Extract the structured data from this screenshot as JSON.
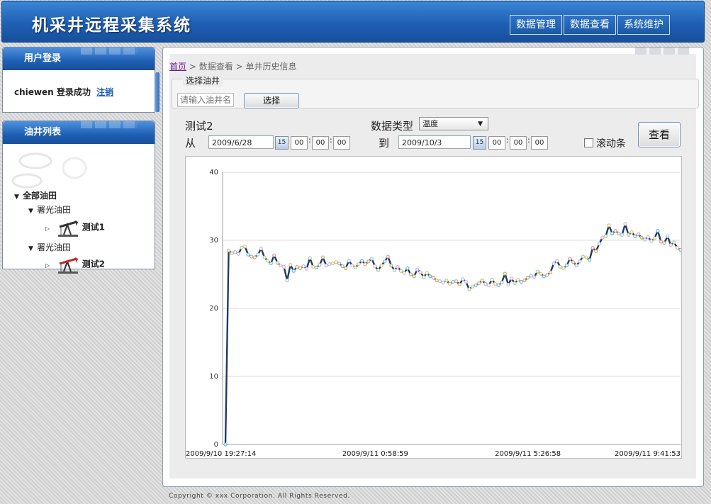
{
  "app": {
    "title": "机采井远程采集系统",
    "nav": [
      "数据管理",
      "数据查看",
      "系统维护"
    ]
  },
  "login_panel": {
    "title": "用户登录",
    "username": "chiewen",
    "status": "登录成功",
    "logout": "注销"
  },
  "well_list": {
    "title": "油井列表",
    "root": "全部油田",
    "fields": [
      {
        "name": "署光油田",
        "well": "测试1"
      },
      {
        "name": "署光油田",
        "well": "测试2"
      }
    ]
  },
  "breadcrumb": {
    "home": "首页",
    "sep": ">",
    "level2": "数据查看",
    "level3": "单井历史信息"
  },
  "well_select": {
    "legend": "选择油井",
    "placeholder": "请输入油井名",
    "button": "选择"
  },
  "query": {
    "well_name": "测试2",
    "from_label": "从",
    "to_label": "到",
    "from_date": "2009/6/28",
    "to_date": "2009/10/3",
    "from_time": [
      "00",
      "00",
      "00"
    ],
    "to_time": [
      "00",
      "00",
      "00"
    ],
    "calendar_icon_text": "15",
    "data_type_label": "数据类型",
    "data_type_value": "温度",
    "scroll_label": "滚动条",
    "view_button": "查看"
  },
  "chart_data": {
    "type": "line",
    "x_ticks": [
      "2009/9/10 19:27:14",
      "2009/9/11 0:58:59",
      "2009/9/11 5:26:58",
      "2009/9/11 9:41:53"
    ],
    "y_ticks": [
      "0",
      "10",
      "20",
      "30",
      "40"
    ],
    "ylim": [
      0,
      40
    ],
    "grid": true,
    "series": [
      {
        "values": [
          0,
          28.5,
          28.1,
          28.3,
          28,
          28.9,
          29.1,
          27.9,
          27.6,
          27.5,
          27.9,
          28.8,
          27.5,
          27,
          26.6,
          27.8,
          26.7,
          26.3,
          26.1,
          24.1,
          26.4,
          25.5,
          26.1,
          25.9,
          26.2,
          25.8,
          27.4,
          26.1,
          26,
          26.4,
          27.5,
          26.3,
          26.5,
          26.6,
          26.8,
          26.6,
          26.2,
          25.9,
          27,
          26.3,
          26,
          26.5,
          27,
          26.5,
          26.9,
          27.3,
          26.2,
          25.6,
          26.3,
          26.9,
          27.6,
          26.3,
          25.6,
          26.1,
          25.5,
          25.2,
          25.9,
          25,
          24.7,
          25.7,
          25.3,
          24.6,
          25.2,
          24.7,
          24.5,
          24.1,
          24,
          23.8,
          24.1,
          23.6,
          23.9,
          24,
          23.5,
          24.3,
          23.9,
          22.8,
          23.2,
          23.4,
          23.7,
          24.1,
          23.6,
          23.4,
          24.2,
          23.6,
          23.4,
          23.8,
          25.1,
          23.5,
          24.4,
          23.7,
          24.2,
          23.9,
          24.1,
          24.5,
          24.8,
          24.6,
          25.4,
          25.1,
          24.7,
          24.9,
          25.3,
          26.6,
          27,
          26.1,
          25.9,
          26.3,
          27.3,
          26.8,
          26.3,
          26.9,
          27.6,
          27.5,
          27.1,
          28.9,
          28.4,
          29.5,
          30.4,
          30.6,
          32.2,
          31,
          31.4,
          31,
          30.8,
          32.4,
          30.8,
          31.2,
          30.6,
          30.9,
          30.4,
          30.1,
          30.5,
          29.9,
          30.3,
          31.4,
          29.8,
          29.6,
          30.6,
          29.3,
          29.7,
          28.9,
          28.6
        ]
      }
    ]
  }
}
